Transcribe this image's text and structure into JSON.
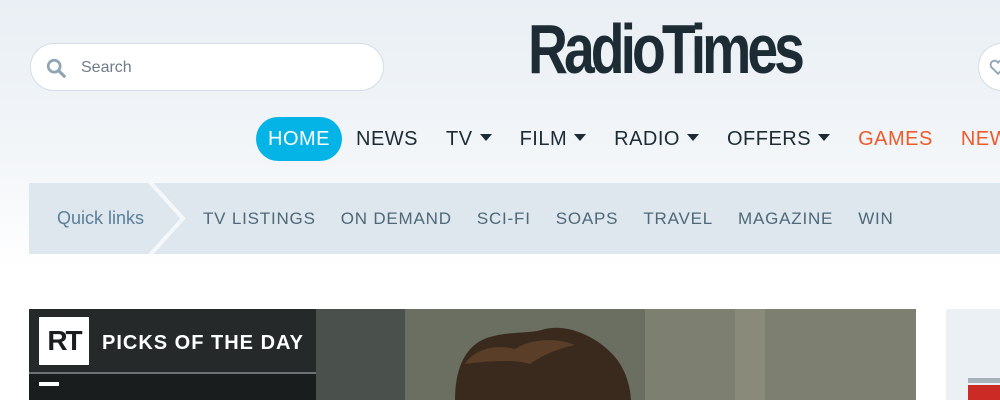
{
  "search": {
    "placeholder": "Search"
  },
  "brand": {
    "logo_text": "RadioTimes",
    "accent_color": "#05b4e6",
    "highlight_color": "#ee5a2a"
  },
  "nav": {
    "items": [
      {
        "label": "HOME",
        "active": true
      },
      {
        "label": "NEWS"
      },
      {
        "label": "TV",
        "dropdown": true
      },
      {
        "label": "FILM",
        "dropdown": true
      },
      {
        "label": "RADIO",
        "dropdown": true
      },
      {
        "label": "OFFERS",
        "dropdown": true
      },
      {
        "label": "GAMES",
        "highlight": true
      },
      {
        "label": "NEW",
        "highlight": true
      }
    ]
  },
  "quick_links": {
    "title": "Quick links",
    "items": [
      "TV LISTINGS",
      "ON DEMAND",
      "SCI-FI",
      "SOAPS",
      "TRAVEL",
      "MAGAZINE",
      "WIN"
    ]
  },
  "picks": {
    "logo_text": "RT",
    "title": "PICKS OF THE DAY"
  },
  "icons": {
    "search": "search-icon",
    "account": "heart-icon",
    "caret": "chevron-down-icon"
  }
}
